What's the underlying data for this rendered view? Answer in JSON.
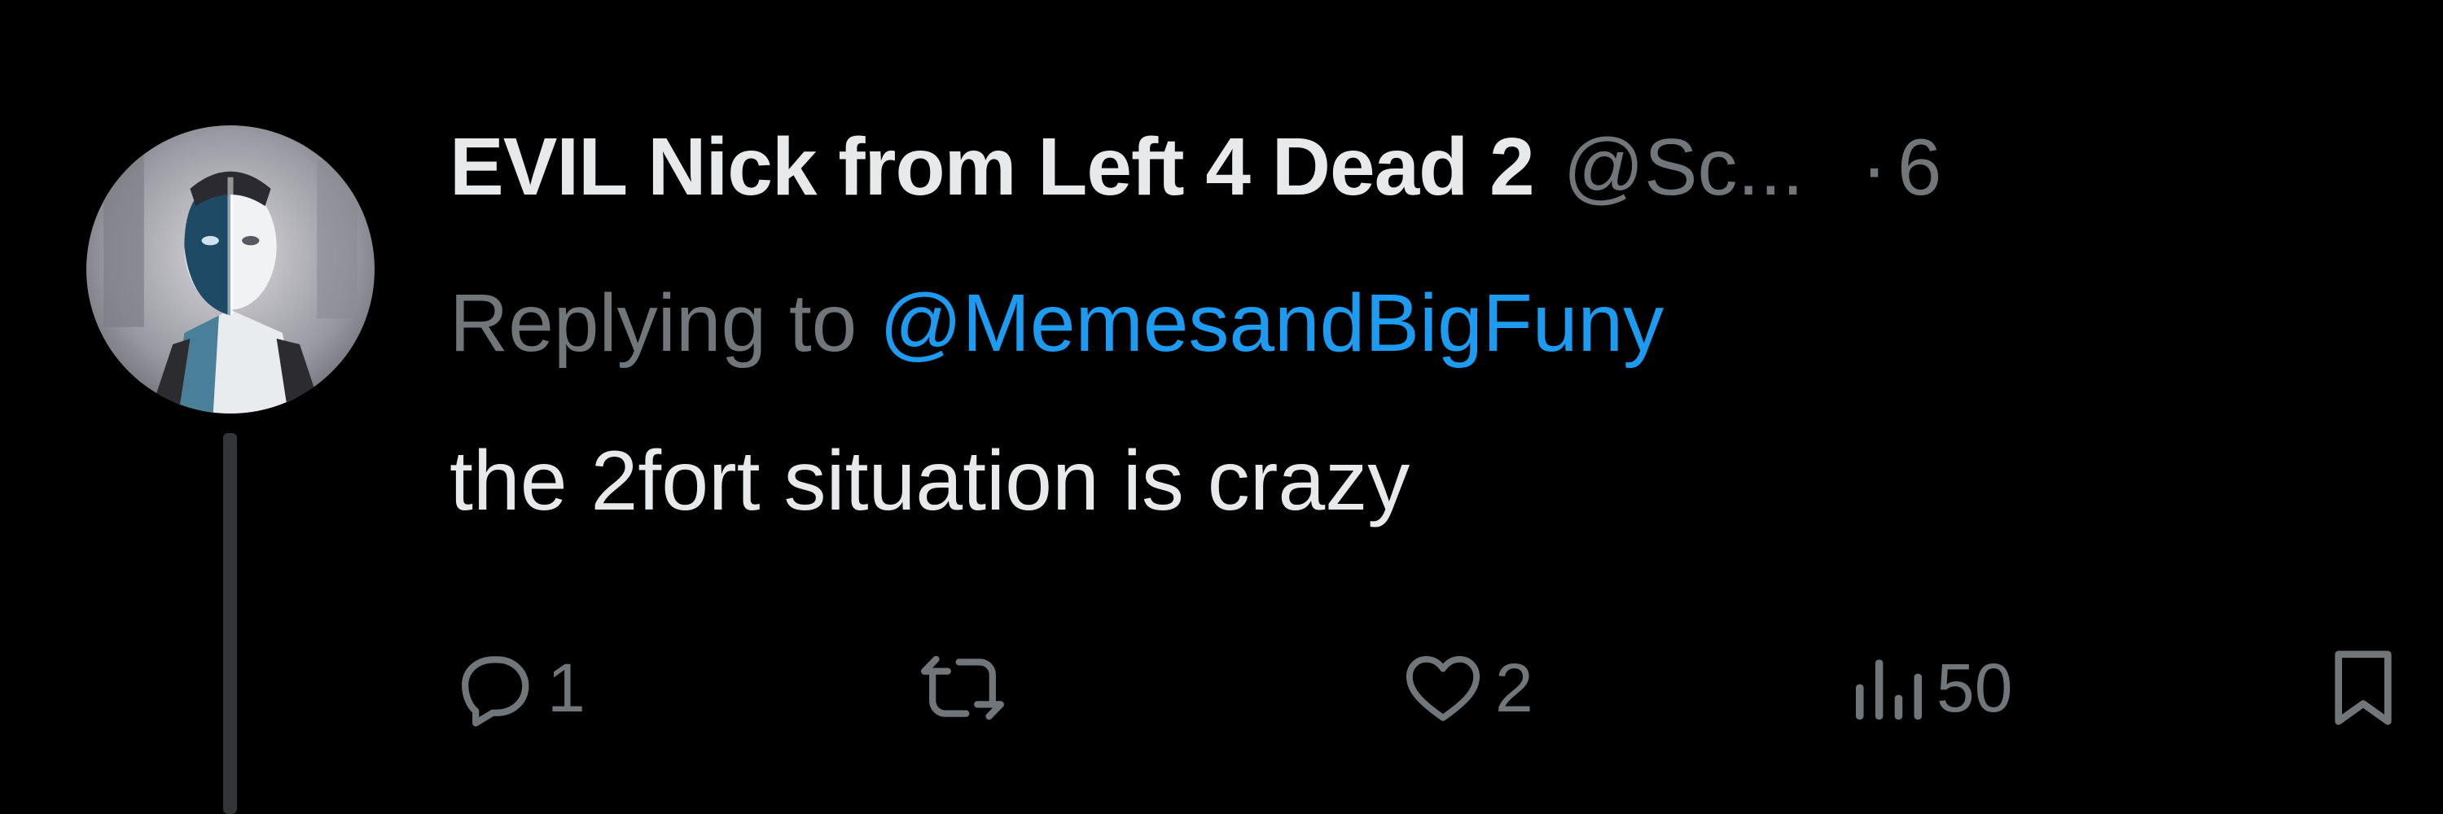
{
  "tweet": {
    "display_name": "EVIL Nick from Left 4 Dead 2",
    "handle": "@Sc...",
    "separator": "·",
    "time": "6",
    "replying_prefix": "Replying to ",
    "replying_to": "@MemesandBigFuny",
    "text": "the 2fort situation is crazy"
  },
  "actions": {
    "replies": "1",
    "retweets": "",
    "likes": "2",
    "views": "50"
  },
  "colors": {
    "background": "#000000",
    "primary_text": "#e7e9ea",
    "secondary_text": "#71767b",
    "accent": "#1d9bf0",
    "thread_line": "#333639"
  },
  "icons": {
    "avatar": "avatar",
    "reply": "reply-icon",
    "retweet": "retweet-icon",
    "like": "heart-icon",
    "views": "views-icon",
    "bookmark": "bookmark-icon"
  }
}
